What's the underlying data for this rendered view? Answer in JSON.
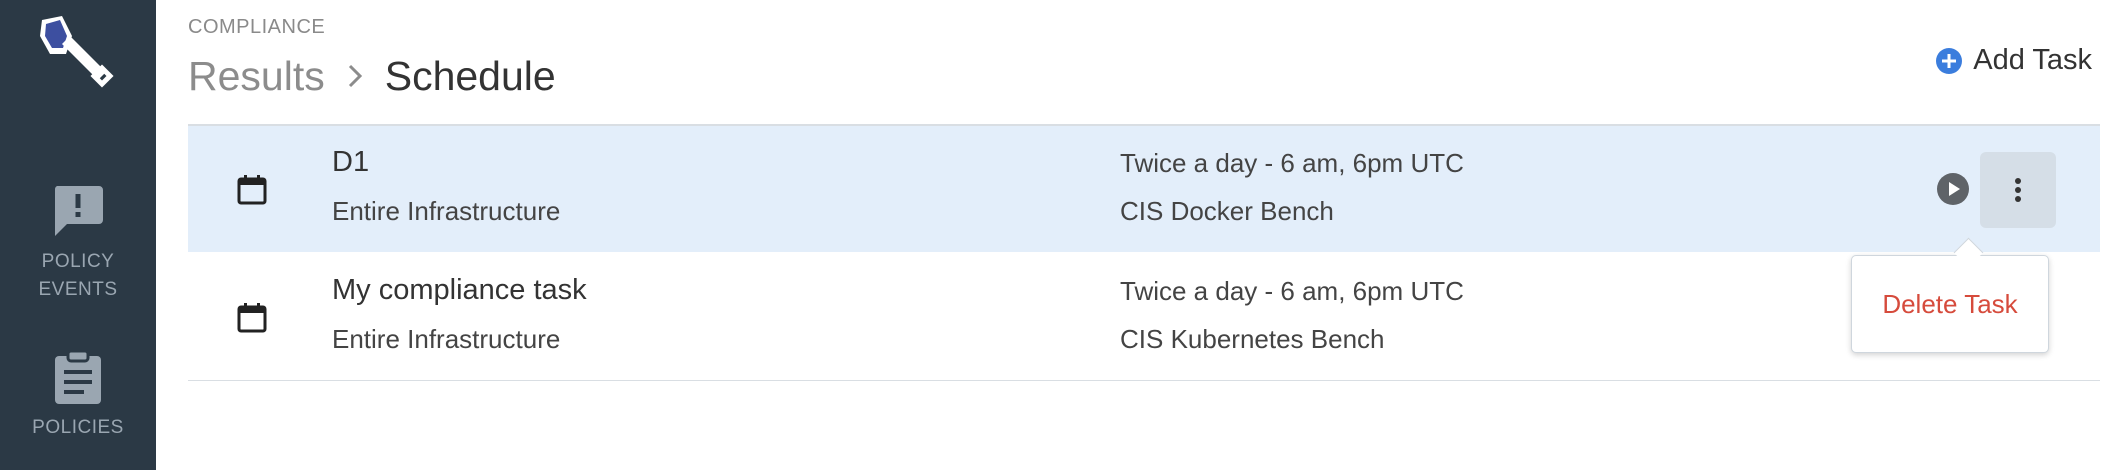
{
  "sidebar": {
    "items": [
      {
        "label_line1": "POLICY",
        "label_line2": "EVENTS",
        "icon": "alert-message-icon"
      },
      {
        "label_line1": "POLICIES",
        "icon": "clipboard-icon"
      }
    ]
  },
  "header": {
    "eyebrow": "COMPLIANCE",
    "breadcrumb": {
      "parent": "Results",
      "current": "Schedule"
    },
    "add_task_label": "Add Task"
  },
  "tasks": [
    {
      "name": "D1",
      "scope": "Entire Infrastructure",
      "schedule": "Twice a day - 6 am, 6pm UTC",
      "benchmark": "CIS Docker Bench",
      "selected": true
    },
    {
      "name": "My compliance task",
      "scope": "Entire Infrastructure",
      "schedule": "Twice a day - 6 am, 6pm UTC",
      "benchmark": "CIS Kubernetes Bench",
      "selected": false
    }
  ],
  "menu": {
    "delete_label": "Delete Task"
  },
  "colors": {
    "sidebar_bg": "#2b3945",
    "selected_row": "#e3eefa",
    "accent_blue": "#3b7ddd",
    "danger": "#d64b3c"
  }
}
